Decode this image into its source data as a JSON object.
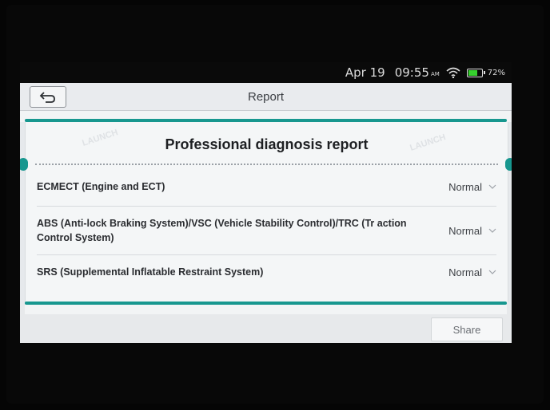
{
  "status_bar": {
    "date": "Apr 19",
    "time": "09:55",
    "ampm": "AM",
    "battery_percent": "72%",
    "battery_level": 0.72
  },
  "header": {
    "title": "Report",
    "back_icon": "back-arrow-icon"
  },
  "report": {
    "title": "Professional diagnosis report",
    "rows": [
      {
        "name": "ECMECT (Engine and ECT)",
        "status": "Normal"
      },
      {
        "name": "ABS (Anti-lock Braking System)/VSC (Vehicle Stability Control)/TRC (Tr action Control System)",
        "status": "Normal"
      },
      {
        "name": "SRS (Supplemental Inflatable Restraint System)",
        "status": "Normal"
      }
    ]
  },
  "footer": {
    "share_label": "Share"
  },
  "colors": {
    "accent": "#17978f",
    "battery": "#36d02e"
  }
}
